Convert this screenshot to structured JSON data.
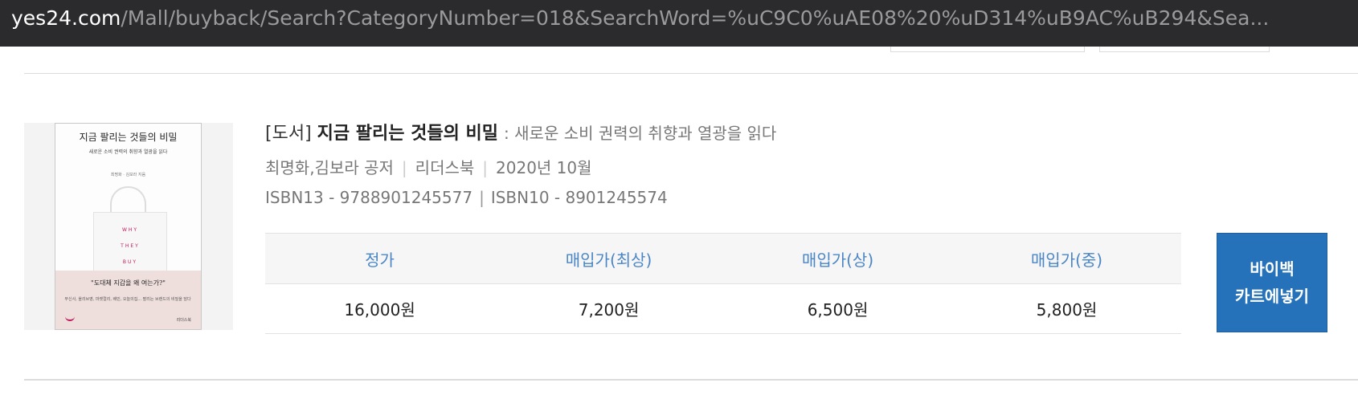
{
  "browser": {
    "url_host": "yes24.com",
    "url_path": "/Mall/buyback/Search?CategoryNumber=018&SearchWord=%uC9C0%uAE08%20%uD314%uB9AC%uB294&Sea..."
  },
  "book": {
    "category": "[도서]",
    "title": "지금 팔리는 것들의 비밀",
    "subtitle": ": 새로운 소비 권력의 취향과 열광을 읽다",
    "authors": "최명화,김보라 공저",
    "publisher": "리더스북",
    "date": "2020년 10월",
    "isbn13": "ISBN13 - 9788901245577",
    "isbn10": "ISBN10 - 8901245574",
    "cover": {
      "title": "지금 팔리는 것들의 비밀",
      "subtitle": "새로운 소비 권력의 취향과 열광을 읽다",
      "author": "최명화 · 김보라 지음",
      "bag_words": [
        "WHY",
        "THEY",
        "BUY"
      ],
      "quote": "\"도대체 지갑을 왜 여는가?\"",
      "blurb": "무신사, 올리브영, 마켓컬리, 배민, 오늘의집... 팔리는 브랜드의 비밀을 담다",
      "publisher_mark": "리더스북"
    }
  },
  "prices": {
    "headers": [
      "정가",
      "매입가(최상)",
      "매입가(상)",
      "매입가(중)"
    ],
    "values": [
      "16,000원",
      "7,200원",
      "6,500원",
      "5,800원"
    ]
  },
  "buyback_button": {
    "line1": "바이백",
    "line2": "카트에넣기"
  },
  "colors": {
    "url_bar_bg": "#2b2b2d",
    "header_text": "#4a86c5",
    "button_bg": "#2672ba"
  }
}
